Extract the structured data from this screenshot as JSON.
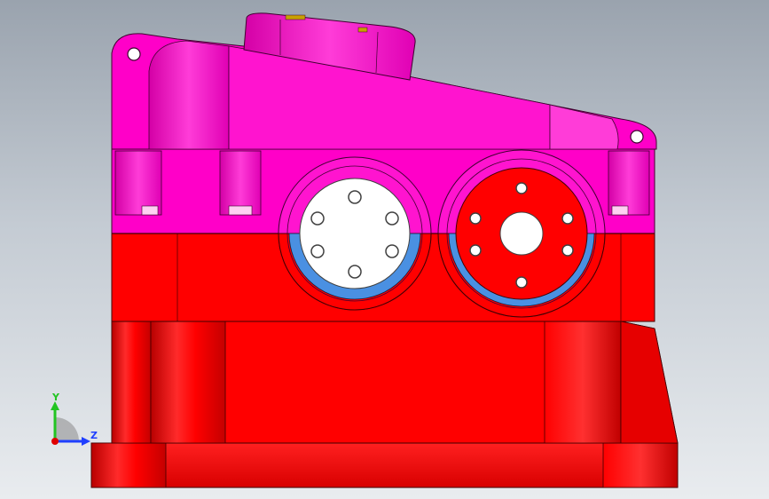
{
  "viewport": {
    "background_top": "#9aa3ae",
    "background_bottom": "#e9ecef"
  },
  "model": {
    "name": "gearbox-housing",
    "upper_housing_color": "#ff00c8",
    "lower_housing_color": "#ff0000",
    "bearing_seal_color": "#4a90e2",
    "left_cover_color": "#ffffff",
    "right_cover_color": "#ff0000"
  },
  "triad": {
    "y_label": "Y",
    "z_label": "Z",
    "y_color": "#22c422",
    "z_color": "#1f3fff",
    "x_color": "#e00000"
  }
}
